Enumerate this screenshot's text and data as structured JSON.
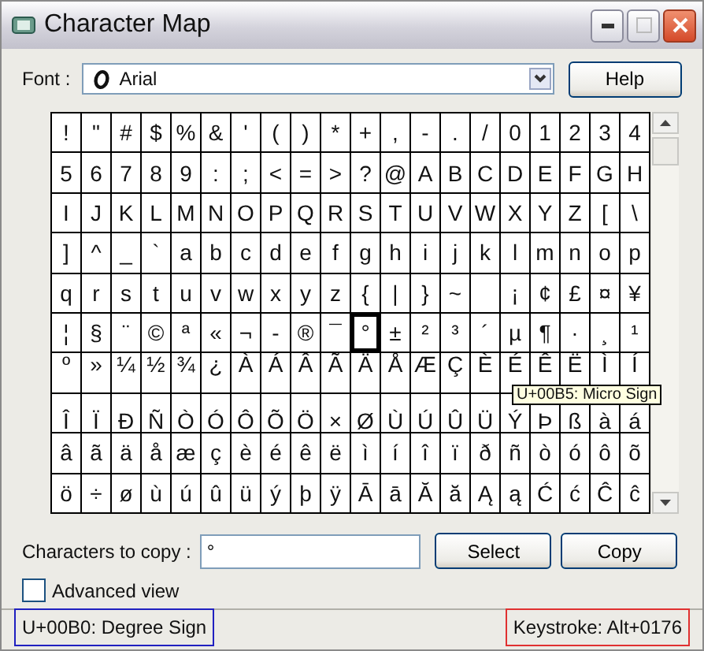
{
  "window": {
    "title": "Character Map"
  },
  "font": {
    "label": "Font :",
    "value": "Arial"
  },
  "help_button": "Help",
  "grid": {
    "rows": [
      [
        {
          "char": "!",
          "selected": false
        },
        {
          "char": "\"",
          "selected": false
        },
        {
          "char": "#",
          "selected": false
        },
        {
          "char": "$",
          "selected": false
        },
        {
          "char": "%",
          "selected": false
        },
        {
          "char": "&",
          "selected": false
        },
        {
          "char": "'",
          "selected": false
        },
        {
          "char": "(",
          "selected": false
        },
        {
          "char": ")",
          "selected": false
        },
        {
          "char": "*",
          "selected": false
        },
        {
          "char": "+",
          "selected": false
        },
        {
          "char": ",",
          "selected": false
        },
        {
          "char": "-",
          "selected": false
        },
        {
          "char": ".",
          "selected": false
        },
        {
          "char": "/",
          "selected": false
        },
        {
          "char": "0",
          "selected": false
        },
        {
          "char": "1",
          "selected": false
        },
        {
          "char": "2",
          "selected": false
        },
        {
          "char": "3",
          "selected": false
        },
        {
          "char": "4",
          "selected": false
        }
      ],
      [
        {
          "char": "5",
          "selected": false
        },
        {
          "char": "6",
          "selected": false
        },
        {
          "char": "7",
          "selected": false
        },
        {
          "char": "8",
          "selected": false
        },
        {
          "char": "9",
          "selected": false
        },
        {
          "char": ":",
          "selected": false
        },
        {
          "char": ";",
          "selected": false
        },
        {
          "char": "<",
          "selected": false
        },
        {
          "char": "=",
          "selected": false
        },
        {
          "char": ">",
          "selected": false
        },
        {
          "char": "?",
          "selected": false
        },
        {
          "char": "@",
          "selected": false
        },
        {
          "char": "A",
          "selected": false
        },
        {
          "char": "B",
          "selected": false
        },
        {
          "char": "C",
          "selected": false
        },
        {
          "char": "D",
          "selected": false
        },
        {
          "char": "E",
          "selected": false
        },
        {
          "char": "F",
          "selected": false
        },
        {
          "char": "G",
          "selected": false
        },
        {
          "char": "H",
          "selected": false
        }
      ],
      [
        {
          "char": "I",
          "selected": false
        },
        {
          "char": "J",
          "selected": false
        },
        {
          "char": "K",
          "selected": false
        },
        {
          "char": "L",
          "selected": false
        },
        {
          "char": "M",
          "selected": false
        },
        {
          "char": "N",
          "selected": false
        },
        {
          "char": "O",
          "selected": false
        },
        {
          "char": "P",
          "selected": false
        },
        {
          "char": "Q",
          "selected": false
        },
        {
          "char": "R",
          "selected": false
        },
        {
          "char": "S",
          "selected": false
        },
        {
          "char": "T",
          "selected": false
        },
        {
          "char": "U",
          "selected": false
        },
        {
          "char": "V",
          "selected": false
        },
        {
          "char": "W",
          "selected": false
        },
        {
          "char": "X",
          "selected": false
        },
        {
          "char": "Y",
          "selected": false
        },
        {
          "char": "Z",
          "selected": false
        },
        {
          "char": "[",
          "selected": false
        },
        {
          "char": "\\",
          "selected": false
        }
      ],
      [
        {
          "char": "]",
          "selected": false
        },
        {
          "char": "^",
          "selected": false
        },
        {
          "char": "_",
          "selected": false
        },
        {
          "char": "`",
          "selected": false
        },
        {
          "char": "a",
          "selected": false
        },
        {
          "char": "b",
          "selected": false
        },
        {
          "char": "c",
          "selected": false
        },
        {
          "char": "d",
          "selected": false
        },
        {
          "char": "e",
          "selected": false
        },
        {
          "char": "f",
          "selected": false
        },
        {
          "char": "g",
          "selected": false
        },
        {
          "char": "h",
          "selected": false
        },
        {
          "char": "i",
          "selected": false
        },
        {
          "char": "j",
          "selected": false
        },
        {
          "char": "k",
          "selected": false
        },
        {
          "char": "l",
          "selected": false
        },
        {
          "char": "m",
          "selected": false
        },
        {
          "char": "n",
          "selected": false
        },
        {
          "char": "o",
          "selected": false
        },
        {
          "char": "p",
          "selected": false
        }
      ],
      [
        {
          "char": "q",
          "selected": false
        },
        {
          "char": "r",
          "selected": false
        },
        {
          "char": "s",
          "selected": false
        },
        {
          "char": "t",
          "selected": false
        },
        {
          "char": "u",
          "selected": false
        },
        {
          "char": "v",
          "selected": false
        },
        {
          "char": "w",
          "selected": false
        },
        {
          "char": "x",
          "selected": false
        },
        {
          "char": "y",
          "selected": false
        },
        {
          "char": "z",
          "selected": false
        },
        {
          "char": "{",
          "selected": false
        },
        {
          "char": "|",
          "selected": false
        },
        {
          "char": "}",
          "selected": false
        },
        {
          "char": "~",
          "selected": false
        },
        {
          "selected": false
        },
        {
          "char": "¡",
          "selected": false
        },
        {
          "char": "¢",
          "selected": false
        },
        {
          "char": "£",
          "selected": false
        },
        {
          "char": "¤",
          "selected": false
        },
        {
          "char": "¥",
          "selected": false
        }
      ],
      [
        {
          "char": "¦",
          "selected": false
        },
        {
          "char": "§",
          "selected": false
        },
        {
          "char": "¨",
          "selected": false
        },
        {
          "char": "©",
          "selected": false
        },
        {
          "char": "ª",
          "selected": false
        },
        {
          "char": "«",
          "selected": false
        },
        {
          "char": "¬",
          "selected": false
        },
        {
          "char": "-",
          "selected": false
        },
        {
          "char": "®",
          "selected": false
        },
        {
          "char": "¯",
          "selected": false
        },
        {
          "char": "°",
          "selected": true
        },
        {
          "char": "±",
          "selected": false
        },
        {
          "char": "²",
          "selected": false
        },
        {
          "char": "³",
          "selected": false
        },
        {
          "char": "´",
          "selected": false
        },
        {
          "char": "µ",
          "selected": false
        },
        {
          "char": "¶",
          "selected": false
        },
        {
          "char": "·",
          "selected": false
        },
        {
          "char": "¸",
          "selected": false
        },
        {
          "char": "¹",
          "selected": false
        }
      ],
      [
        {
          "char": "º",
          "selected": false
        },
        {
          "char": "»",
          "selected": false
        },
        {
          "char": "¼",
          "selected": false
        },
        {
          "char": "½",
          "selected": false
        },
        {
          "char": "¾",
          "selected": false
        },
        {
          "char": "¿",
          "selected": false
        },
        {
          "char": "À",
          "selected": false
        },
        {
          "char": "Á",
          "selected": false
        },
        {
          "char": "Â",
          "selected": false
        },
        {
          "char": "Ã",
          "selected": false
        },
        {
          "char": "Ä",
          "selected": false
        },
        {
          "char": "Å",
          "selected": false
        },
        {
          "char": "Æ",
          "selected": false
        },
        {
          "char": "Ç",
          "selected": false
        },
        {
          "char": "È",
          "selected": false
        },
        {
          "char": "É",
          "selected": false
        },
        {
          "char": "Ê",
          "selected": false
        },
        {
          "char": "Ë",
          "selected": false
        },
        {
          "char": "Ì",
          "selected": false
        },
        {
          "char": "Í",
          "selected": false
        }
      ],
      [
        {
          "char": "Î",
          "selected": false
        },
        {
          "char": "Ï",
          "selected": false
        },
        {
          "char": "Ð",
          "selected": false
        },
        {
          "char": "Ñ",
          "selected": false
        },
        {
          "char": "Ò",
          "selected": false
        },
        {
          "char": "Ó",
          "selected": false
        },
        {
          "char": "Ô",
          "selected": false
        },
        {
          "char": "Õ",
          "selected": false
        },
        {
          "char": "Ö",
          "selected": false
        },
        {
          "char": "×",
          "selected": false
        },
        {
          "char": "Ø",
          "selected": false
        },
        {
          "char": "Ù",
          "selected": false
        },
        {
          "char": "Ú",
          "selected": false
        },
        {
          "char": "Û",
          "selected": false
        },
        {
          "char": "Ü",
          "selected": false
        },
        {
          "char": "Ý",
          "selected": false
        },
        {
          "char": "Þ",
          "selected": false
        },
        {
          "char": "ß",
          "selected": false
        },
        {
          "char": "à",
          "selected": false
        },
        {
          "char": "á",
          "selected": false
        }
      ],
      [
        {
          "char": "â",
          "selected": false
        },
        {
          "char": "ã",
          "selected": false
        },
        {
          "char": "ä",
          "selected": false
        },
        {
          "char": "å",
          "selected": false
        },
        {
          "char": "æ",
          "selected": false
        },
        {
          "char": "ç",
          "selected": false
        },
        {
          "char": "è",
          "selected": false
        },
        {
          "char": "é",
          "selected": false
        },
        {
          "char": "ê",
          "selected": false
        },
        {
          "char": "ë",
          "selected": false
        },
        {
          "char": "ì",
          "selected": false
        },
        {
          "char": "í",
          "selected": false
        },
        {
          "char": "î",
          "selected": false
        },
        {
          "char": "ï",
          "selected": false
        },
        {
          "char": "ð",
          "selected": false
        },
        {
          "char": "ñ",
          "selected": false
        },
        {
          "char": "ò",
          "selected": false
        },
        {
          "char": "ó",
          "selected": false
        },
        {
          "char": "ô",
          "selected": false
        },
        {
          "char": "õ",
          "selected": false
        }
      ],
      [
        {
          "char": "ö",
          "selected": false
        },
        {
          "char": "÷",
          "selected": false
        },
        {
          "char": "ø",
          "selected": false
        },
        {
          "char": "ù",
          "selected": false
        },
        {
          "char": "ú",
          "selected": false
        },
        {
          "char": "û",
          "selected": false
        },
        {
          "char": "ü",
          "selected": false
        },
        {
          "char": "ý",
          "selected": false
        },
        {
          "char": "þ",
          "selected": false
        },
        {
          "char": "ÿ",
          "selected": false
        },
        {
          "char": "Ā",
          "selected": false
        },
        {
          "char": "ā",
          "selected": false
        },
        {
          "char": "Ă",
          "selected": false
        },
        {
          "char": "ă",
          "selected": false
        },
        {
          "char": "Ą",
          "selected": false
        },
        {
          "char": "ą",
          "selected": false
        },
        {
          "char": "Ć",
          "selected": false
        },
        {
          "char": "ć",
          "selected": false
        },
        {
          "char": "Ĉ",
          "selected": false
        },
        {
          "char": "ĉ",
          "selected": false
        }
      ]
    ]
  },
  "tooltip": {
    "text": "U+00B5: Micro Sign"
  },
  "copy": {
    "label": "Characters to copy :",
    "value": "°"
  },
  "buttons": [
    "Select",
    "Copy"
  ],
  "advanced_view": {
    "label": "Advanced view",
    "checked": false
  },
  "status_bar": {
    "character": "U+00B0: Degree Sign",
    "keystroke": "Keystroke: Alt+0176"
  }
}
